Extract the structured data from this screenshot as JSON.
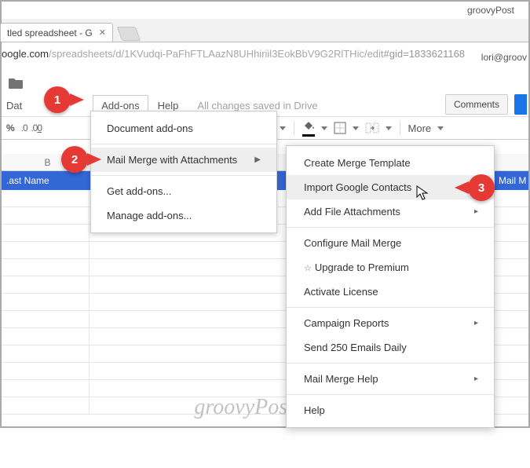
{
  "titlebar": {
    "site": "groovyPost"
  },
  "browser": {
    "tab_title": "tled spreadsheet - G",
    "url_host": "oogle.com",
    "url_path": "/spreadsheets/d/1KVudqi-PaFhFTLAazN8UHhiriil3EokBbV9G2RlTHic/edit",
    "url_query": "#gid=1833621168"
  },
  "account": "lori@groov",
  "menubar": {
    "data": "Dat",
    "addons": "Add-ons",
    "help": "Help",
    "status": "All changes saved in Drive"
  },
  "right_buttons": {
    "comments": "Comments"
  },
  "fmt": {
    "percent": "%",
    "more": "More"
  },
  "columns": {
    "a": ".ast Name",
    "b": "B",
    "g_label": "Mail M"
  },
  "dropdown1": {
    "doc_addons": "Document add-ons",
    "mail_merge": "Mail Merge with Attachments",
    "get_addons": "Get add-ons...",
    "manage_addons": "Manage add-ons..."
  },
  "dropdown2": {
    "create_template": "Create Merge Template",
    "import_contacts": "Import Google Contacts",
    "add_attachments": "Add File Attachments",
    "configure": "Configure Mail Merge",
    "upgrade": "Upgrade to Premium",
    "activate": "Activate License",
    "campaign_reports": "Campaign Reports",
    "send_250": "Send 250 Emails Daily",
    "mm_help": "Mail Merge Help",
    "help": "Help"
  },
  "callouts": {
    "one": "1",
    "two": "2",
    "three": "3"
  },
  "watermark": "groovyPost.com"
}
